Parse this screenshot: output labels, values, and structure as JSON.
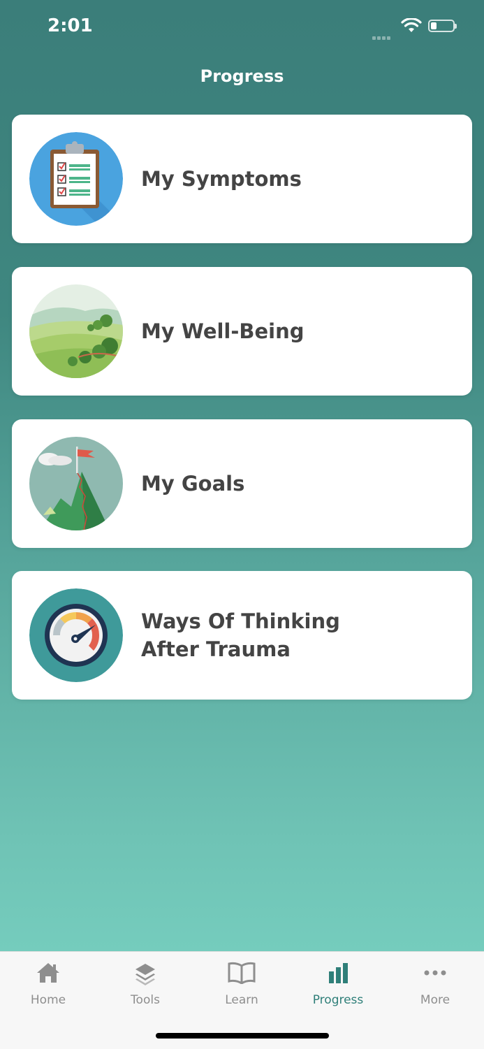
{
  "status": {
    "time": "2:01"
  },
  "header": {
    "title": "Progress"
  },
  "cards": [
    {
      "lines": [
        "My Symptoms"
      ],
      "icon": "clipboard-checklist-icon"
    },
    {
      "lines": [
        "My Well-Being"
      ],
      "icon": "landscape-hills-icon"
    },
    {
      "lines": [
        "My Goals"
      ],
      "icon": "mountain-flag-icon"
    },
    {
      "lines": [
        "Ways Of Thinking",
        "After Trauma"
      ],
      "icon": "speedometer-gauge-icon"
    }
  ],
  "tabs": [
    {
      "label": "Home",
      "icon": "home-icon",
      "active": false
    },
    {
      "label": "Tools",
      "icon": "layers-icon",
      "active": false
    },
    {
      "label": "Learn",
      "icon": "book-icon",
      "active": false
    },
    {
      "label": "Progress",
      "icon": "bar-chart-icon",
      "active": true
    },
    {
      "label": "More",
      "icon": "more-dots-icon",
      "active": false
    }
  ],
  "colors": {
    "accent": "#2f7f79",
    "inactive": "#8e8e8e",
    "text": "#444444"
  }
}
